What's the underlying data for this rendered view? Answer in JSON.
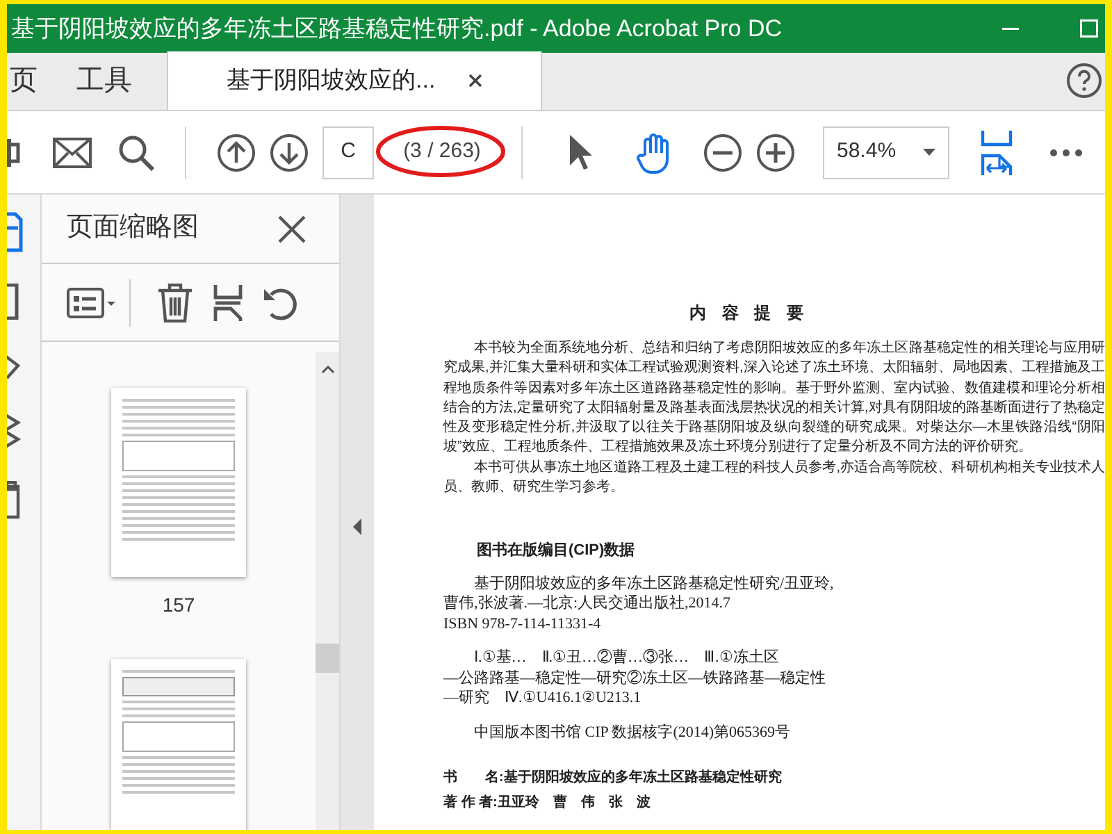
{
  "window": {
    "title": "基于阴阳坡效应的多年冻土区路基稳定性研究.pdf - Adobe Acrobat Pro DC"
  },
  "tabs": [
    {
      "label": "页",
      "selected": false,
      "kind": "nav"
    },
    {
      "label": "工具",
      "selected": false,
      "kind": "nav"
    },
    {
      "label": "基于阴阳坡效应的...",
      "selected": true,
      "kind": "document"
    }
  ],
  "toolbar": {
    "page_input": "C",
    "page_count": "(3 / 263)",
    "zoom": "58.4%",
    "tools": [
      {
        "kind": "select",
        "selected": false
      },
      {
        "kind": "hand",
        "selected": true
      }
    ]
  },
  "thumbnails_panel": {
    "title": "页面缩略图",
    "pages": [
      {
        "kind": "chart-page",
        "label": "157"
      },
      {
        "kind": "table-page"
      }
    ]
  },
  "document": {
    "heading": "内 容 提 要",
    "paragraphs": [
      "本书较为全面系统地分析、总结和归纳了考虑阴阳坡效应的多年冻土区路基稳定性的相关理论与应用研究成果,并汇集大量科研和实体工程试验观测资料,深入论述了冻土环境、太阳辐射、局地因素、工程措施及工程地质条件等因素对多年冻土区道路路基稳定性的影响。基于野外监测、室内试验、数值建模和理论分析相结合的方法,定量研究了太阳辐射量及路基表面浅层热状况的相关计算,对具有阴阳坡的路基断面进行了热稳定性及变形稳定性分析,并汲取了以往关于路基阴阳坡及纵向裂缝的研究成果。对柴达尔—木里铁路沿线“阴阳坡”效应、工程地质条件、工程措施效果及冻土环境分别进行了定量分析及不同方法的评价研究。",
      "本书可供从事冻土地区道路工程及土建工程的科技人员参考,亦适合高等院校、科研机构相关专业技术人员、教师、研究生学习参考。"
    ],
    "cip_title": "图书在版编目(CIP)数据",
    "cip_paragraphs": [
      "基于阴阳坡效应的多年冻土区路基稳定性研究/丑亚玲,\n曹伟,张波著.—北京:人民交通出版社,2014.7\nISBN 978-7-114-11331-4",
      "Ⅰ.①基…　Ⅱ.①丑…②曹…③张…　Ⅲ.①冻土区\n—公路路基—稳定性—研究②冻土区—铁路路基—稳定性\n—研究　Ⅳ.①U416.1②U213.1",
      "中国版本图书馆 CIP 数据核字(2014)第065369号"
    ],
    "colophon": [
      "书　　名:基于阴阳坡效应的多年冻土区路基稳定性研究",
      "著 作 者:丑亚玲　曹　伟　张　波"
    ]
  }
}
